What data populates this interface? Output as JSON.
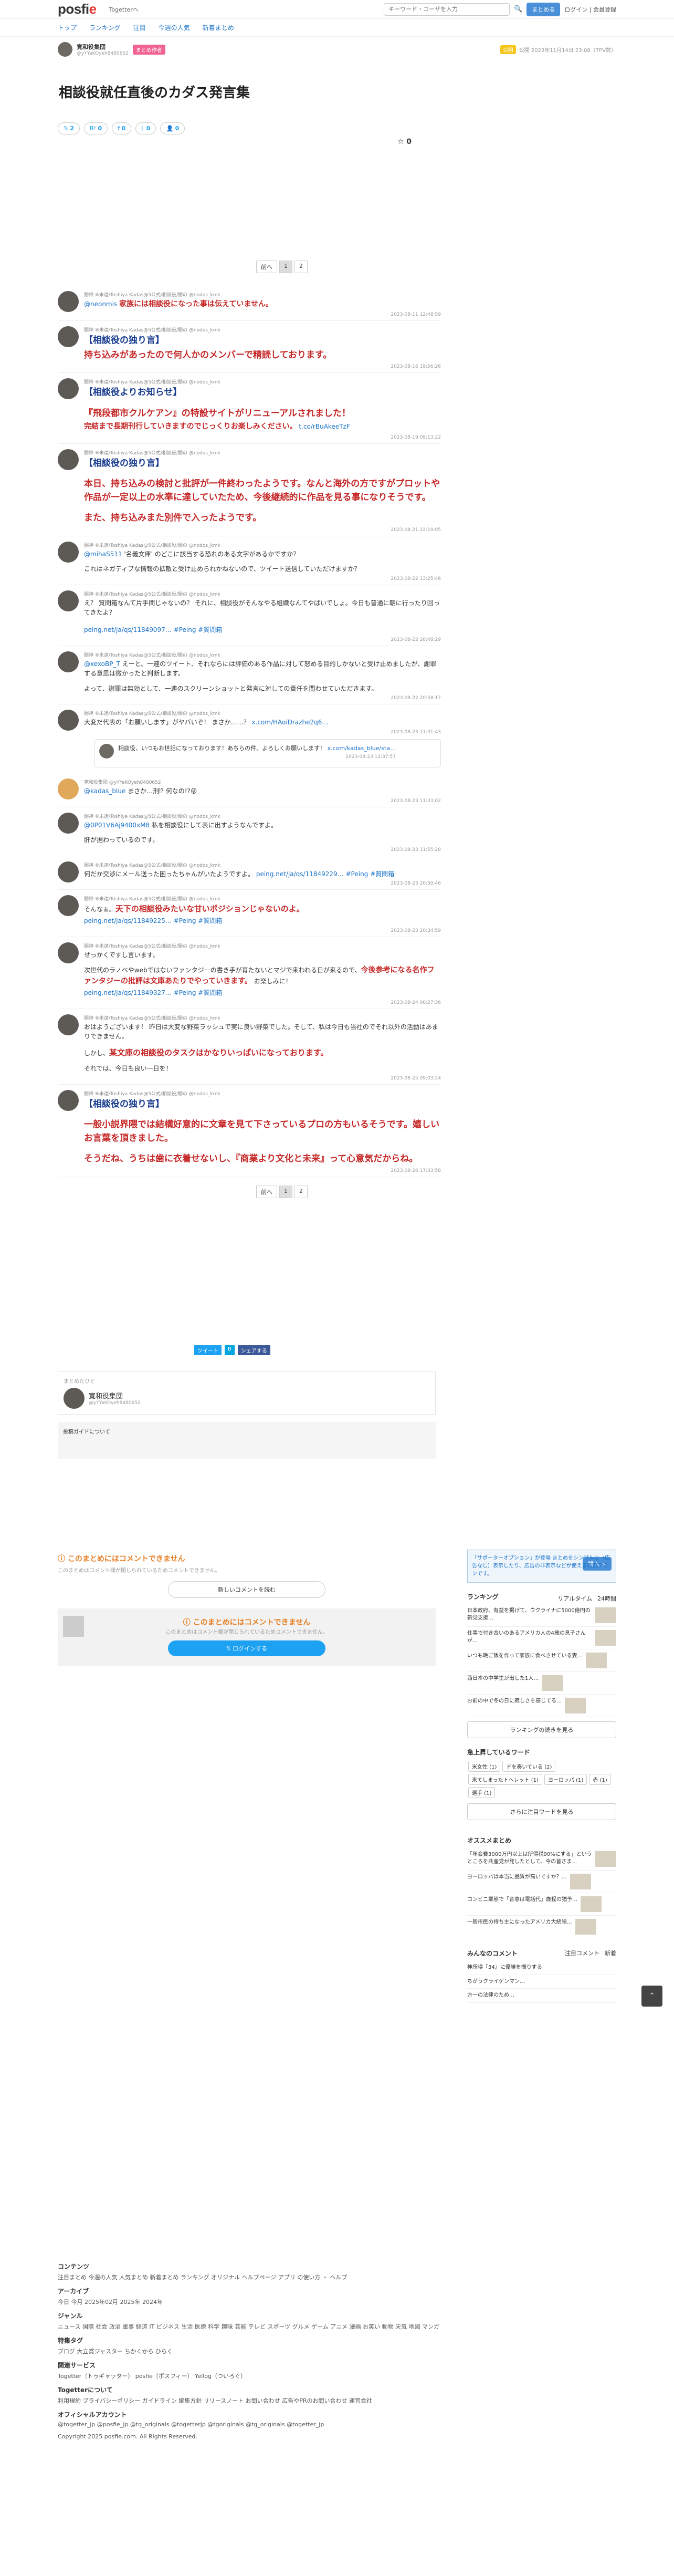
{
  "header": {
    "logo_a": "posfi",
    "logo_b": "e",
    "togetter": "Togetterへ",
    "search_placeholder": "キーワード・ユーザを入力",
    "search_btn": "まとめる",
    "login": "ログイン | 会員登録"
  },
  "nav": [
    "トップ",
    "ランキング",
    "注目",
    "今週の人気",
    "新着まとめ"
  ],
  "author": {
    "name": "寛和役集団",
    "id": "@yYYaKOyeh8480652",
    "badge": "まとめ作者",
    "chip": "公開",
    "meta": "公開 2023年11月14日 23:08（7PV数）"
  },
  "title": "相談役就任直後のカダス発言集",
  "share": {
    "tw": "2",
    "hb": "0",
    "fb": "0",
    "line": "0",
    "count": "0",
    "fav": "0"
  },
  "pager": {
    "prev": "前へ",
    "p1": "1",
    "p2": "2"
  },
  "tweets": [
    {
      "head": "闇神 ⑥未達/Toshiya Kadas@5公式/相談役/闇の @nodos_kmk",
      "mention": "@neonmis",
      "text": "家族には相談役になった事は伝えていません。",
      "date": "2023-08-11 12:48:59"
    },
    {
      "head": "闇神 ⑥未達/Toshiya Kadas@5公式/相談役/闇の @nodos_kmk",
      "text": "【相談役の独り言】",
      "big": "持ち込みがあったので何人かのメンバーで精読しております。",
      "date": "2023-08-16 19:56:26"
    },
    {
      "head": "闇神 ⑥未達/Toshiya Kadas@5公式/相談役/闇の @nodos_kmk",
      "text": "【相談役よりお知らせ】",
      "big": "『飛段都市クルケアン』の特設サイトがリニューアルされました！",
      "text2": "完結まで長期刊行していきますのでじっくりお楽しみください。",
      "link": "t.co/rBuAkeeTzF",
      "date": "2023-08-19 09:13:22"
    },
    {
      "head": "闇神 ⑥未達/Toshiya Kadas@5公式/相談役/闇の @nodos_kmk",
      "text": "【相談役の独り言】",
      "big": "本日、持ち込みの検討と批評が一件終わったようです。なんと海外の方ですがプロットや作品が一定以上の水準に達していたため、今後継続的に作品を見る事になりそうです。",
      "big2": "また、持ち込みまた別件で入ったようです。",
      "date": "2023-08-21 22:19:05"
    },
    {
      "head": "闇神 ⑥未達/Toshiya Kadas@5公式/相談役/闇の @nodos_kmk",
      "mention": "@mihaS511",
      "text": "'名義文庫' のどこに該当する恐れのある文字があるかですか？",
      "text2": "これはネガティブな情報の拡散と受け止められかねないので、ツイート送信していただけますか？",
      "date": "2023-08-22 13:25:46"
    },
    {
      "head": "闇神 ⑥未達/Toshiya Kadas@5公式/相談役/闇の @nodos_kmk",
      "text": "え？ 質問箱なんて片手間じゃないの？ それに、相談役がそんなやる組織なんてやばいでしょ。今日も普通に朝に行ったり回ってきたよ？",
      "link": "peing.net/ja/qs/11849097… #Peing #質問箱",
      "date": "2023-08-22 20:48:29"
    },
    {
      "head": "闇神 ⑥未達/Toshiya Kadas@5公式/相談役/闇の @nodos_kmk",
      "mention": "@xexoBP_T",
      "text": "えーと、一連のツイート、それならには評価のある作品に対して怒める目的しかないと受け止めましたが、謝罪する意思は微かったと判断します。",
      "text2": "よって、謝罪は無効として、一連のスクリーンショットと発言に対しての責任を問わせていただきます。",
      "date": "2023-08-22 20:58:17"
    },
    {
      "head": "闇神 ⑥未達/Toshiya Kadas@5公式/相談役/闇の @nodos_kmk",
      "text": "大変だ代表の「お願いします」がヤバいぞ！ まさか……？",
      "link": "x.com/HAoiDrazhe2q6…",
      "quote": "相談役、いつもお世話になっております！あちらの件、よろしくお願いします！",
      "quote_link": "x.com/kadas_blue/sta…",
      "quote_date": "2023-08-23 11:37:57",
      "date": "2023-08-23 11:31:43"
    },
    {
      "head": "寛和役集団 @yYYaKOyeh8480652",
      "mention": "@kadas_blue",
      "text": "まさか…刑⁉ 何なの!?😝",
      "date": "2023-08-23 11:33:02"
    },
    {
      "head": "闇神 ⑥未達/Toshiya Kadas@5公式/相談役/闇の @nodos_kmk",
      "mention": "@0P01V6Aj9400xM8",
      "text": "私を相談役にして表に出すようなんですよ。",
      "text2": "肝が据わっているのです。",
      "date": "2023-08-23 11:55:28"
    },
    {
      "head": "闇神 ⑥未達/Toshiya Kadas@5公式/相談役/闇の @nodos_kmk",
      "text": "何だか交渉にメール送った困ったちゃんがいたようですよ。",
      "link": "peing.net/ja/qs/11849229… #Peing #質問箱",
      "date": "2023-08-23 20:30:46"
    },
    {
      "head": "闇神 ⑥未達/Toshiya Kadas@5公式/相談役/闇の @nodos_kmk",
      "text": "そんなぁ。",
      "big": "天下の相談役みたいな甘いポジションじゃないのよ。",
      "link": "peing.net/ja/qs/11849225… #Peing #質問箱",
      "date": "2023-08-23 20:34:59"
    },
    {
      "head": "闇神 ⑥未達/Toshiya Kadas@5公式/相談役/闇の @nodos_kmk",
      "text": "せっかくですし言います。",
      "text2": "次世代のラノベやwebではないファンタジーの書き手が育たないとマジで来われる日が来るので、",
      "big": "今後参考になる名作ファンタジーの批評は文庫あたりでやっていきます。",
      "text3": "お楽しみに！",
      "link": "peing.net/ja/qs/11849327… #Peing #質問箱",
      "date": "2023-08-24 00:27:36"
    },
    {
      "head": "闇神 ⑥未達/Toshiya Kadas@5公式/相談役/闇の @nodos_kmk",
      "text": "おはようございます！ 昨日は大変な野菜ラッシュで実に良い野菜でした。そして、私は今日も当社のでそれ以外の活動はあまりできません。",
      "text2": "しかし、",
      "big": "某文庫の相談役のタスクはかなりいっぱいになっております。",
      "text3": "それでは、今日も良い一日を！",
      "date": "2023-08-25 09:03:24"
    },
    {
      "head": "闇神 ⑥未達/Toshiya Kadas@5公式/相談役/闇の @nodos_kmk",
      "text": "【相談役の独り言】",
      "big": "一般小説界隈では結構好意的に文章を見て下さっているプロの方もいるそうです。嬉しいお言葉を頂きました。",
      "big2": "そうだね、うちは歯に衣着せないし、『商業より文化と未来』って心意気だからね。",
      "date": "2023-08-26 17:33:58"
    }
  ],
  "share2": {
    "tw": "ツイート",
    "hb": "B",
    "fb": "シェアする"
  },
  "author_box": {
    "label": "まとめたひと",
    "name": "寛和役集団",
    "id": "@yYYaKOyeh8480652"
  },
  "note": "投稿ガイドについて",
  "sidebar": {
    "banner": "「サポーターオプション」が登場 まとめをシンプルに（広告なし）表示したり、広告の非表示などが使える有償プランです。",
    "banner_btn": "購入 >",
    "ranking_title": "ランキング",
    "rank_tab1": "リアルタイム",
    "rank_tab2": "24時間",
    "ranks": [
      "日本政府、有益を掲げて、ウクライナに5000億円の新党支援…",
      "仕事で付き合いのあるアメリカ人の4歳の息子さんが…",
      "いつも晩ご飯を作って家族に食べさせている妻…",
      "西日本の中学生が出した1人…",
      "お前の中で冬の日に寂しさを感じてる…"
    ],
    "rank_btn": "ランキングの続きを見る",
    "words_title": "急上昇しているワード",
    "words": [
      "米女性 (1)",
      "ドを奏いている (2)",
      "来てしまったトヘレット (1)",
      "ヨーロッパ (1)",
      "赤 (1)",
      "選手 (1)"
    ],
    "words_btn": "さらに注目ワードを見る",
    "osusume_title": "オススメまとめ",
    "osusume": [
      "「年会費3000万円以上は所得税90%にする」というところを共産党が発したとして、今の皆さま…",
      "ヨーロッパは本当に品質が高いですか？…",
      "コンビニ業態で「合意は電話代」歳程の猶予…",
      "一般市民の持ち主になったアメリカ大統領…"
    ],
    "comments_title": "みんなのコメント",
    "c_tab1": "注目コメント",
    "c_tab2": "新着",
    "comments": [
      "神所得『34』に優勝を撮りする",
      "ちがうクライゲンマン…",
      "方一の法律のため…"
    ]
  },
  "comments_area": {
    "warn": "このまとめにはコメントできません",
    "sub": "このまとめはコメント欄が閉じられているためコメントできません。",
    "read": "新しいコメントを読む",
    "login": "ログインする"
  },
  "footer": {
    "content": "コンテンツ",
    "content_items": "注目まとめ 今週の人気 人気まとめ 新着まとめ ランキング オリジナル ヘルプページ アプリ の使い方 ・ ヘルプ",
    "archive": "アーカイブ",
    "archive_items": "今日 今月 2025年02月 2025年 2024年",
    "genre": "ジャンル",
    "genre_items": "ニュース 国際 社会 政治 軍事 経済 IT ビジネス 生活 医療 科学 趣味 芸能 テレビ スポーツ グルメ ゲーム アニメ 漫画 お笑い 動物 天気 地図 マンガ",
    "special": "特集タグ",
    "special_items": "ブログ 大立賞ジャスター ちかくから ひらく",
    "related": "関連サービス",
    "related_items": "Togetter（トゥギャッター） posfie（ポスフィー） Yellog（ついろぐ）",
    "about": "Togetterについて",
    "about_items": "利用規約 プライバシーポリシー ガイドライン 編集方針 リリースノート お問い合わせ 広告やPRのお問い合わせ 運営会社",
    "official": "オフィシャルアカウント",
    "official_items": "@togetter_jp @posfie_jp @tg_originals @togetterjp @tgoriginals @tg_originals @togetter_jp",
    "copyright": "Copyright 2025 posfie.com. All Rights Reserved."
  }
}
